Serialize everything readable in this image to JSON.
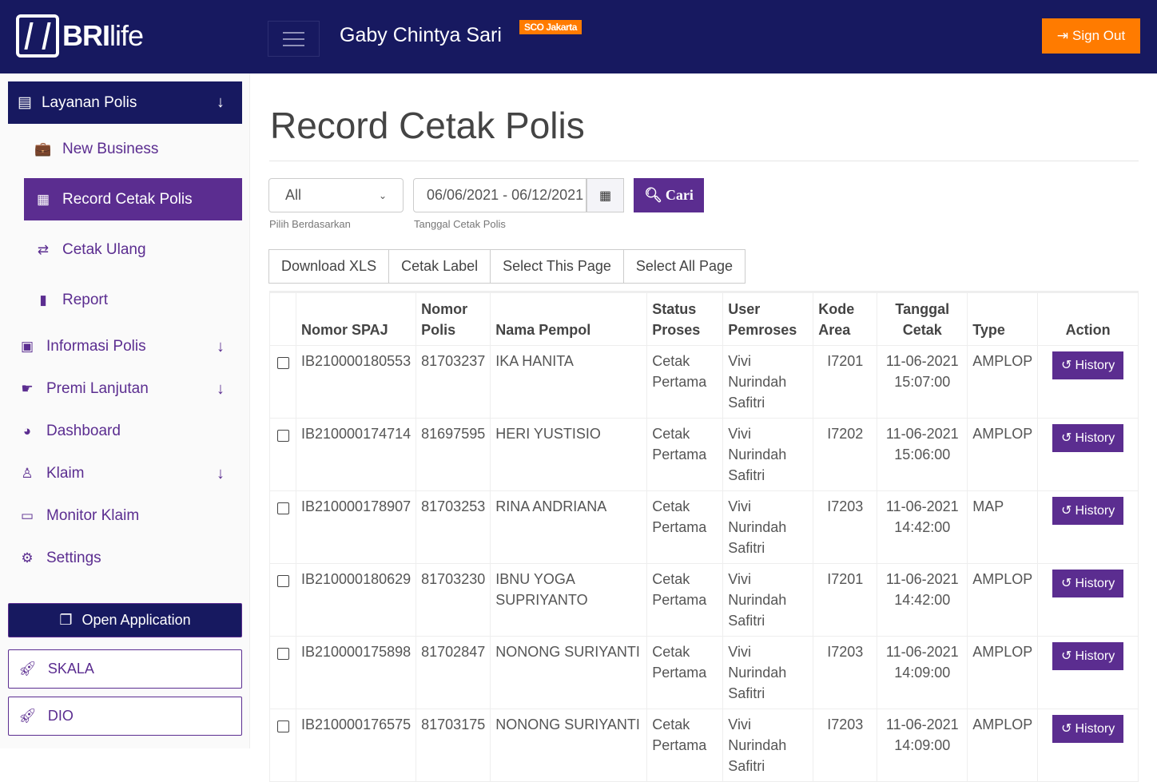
{
  "header": {
    "logo": "BRIlife",
    "user_name": "Gaby Chintya Sari",
    "branch_badge": "SCO Jakarta",
    "sign_out": "Sign Out"
  },
  "sidebar": {
    "section": "Layanan Polis",
    "sub_items": [
      {
        "label": "New Business",
        "icon": "briefcase-clock-icon"
      },
      {
        "label": "Record Cetak Polis",
        "icon": "receipt-icon",
        "active": true
      },
      {
        "label": "Cetak Ulang",
        "icon": "retweet-icon"
      },
      {
        "label": "Report",
        "icon": "book-icon"
      }
    ],
    "items": [
      {
        "label": "Informasi Polis",
        "icon": "id-badge-icon",
        "expandable": true
      },
      {
        "label": "Premi Lanjutan",
        "icon": "hand-money-icon",
        "expandable": true
      },
      {
        "label": "Dashboard",
        "icon": "gauge-icon"
      },
      {
        "label": "Klaim",
        "icon": "user-doctor-icon",
        "expandable": true
      },
      {
        "label": "Monitor Klaim",
        "icon": "desktop-icon"
      },
      {
        "label": "Settings",
        "icon": "users-cog-icon"
      }
    ],
    "open_application": "Open Application",
    "external": [
      "SKALA",
      "DIO"
    ]
  },
  "page": {
    "title": "Record Cetak Polis"
  },
  "filters": {
    "select_value": "All",
    "select_hint": "Pilih Berdasarkan",
    "date_value": "06/06/2021 - 06/12/2021",
    "date_hint": "Tanggal Cetak Polis",
    "search_label": "Cari"
  },
  "actions": [
    "Download XLS",
    "Cetak Label",
    "Select This Page",
    "Select All Page"
  ],
  "table": {
    "headers": [
      "Nomor SPAJ",
      "Nomor Polis",
      "Nama Pempol",
      "Status Proses",
      "User Pemroses",
      "Kode Area",
      "Tanggal Cetak",
      "Type",
      "Action"
    ],
    "history_label": "History",
    "rows": [
      {
        "spaj": "IB210000180553",
        "polis": "81703237",
        "nama": "IKA HANITA",
        "status": "Cetak Pertama",
        "user": "Vivi Nurindah Safitri",
        "area": "I7201",
        "tanggal": "11-06-2021 15:07:00",
        "type": "AMPLOP"
      },
      {
        "spaj": "IB210000174714",
        "polis": "81697595",
        "nama": "HERI YUSTISIO",
        "status": "Cetak Pertama",
        "user": "Vivi Nurindah Safitri",
        "area": "I7202",
        "tanggal": "11-06-2021 15:06:00",
        "type": "AMPLOP"
      },
      {
        "spaj": "IB210000178907",
        "polis": "81703253",
        "nama": "RINA ANDRIANA",
        "status": "Cetak Pertama",
        "user": "Vivi Nurindah Safitri",
        "area": "I7203",
        "tanggal": "11-06-2021 14:42:00",
        "type": "MAP"
      },
      {
        "spaj": "IB210000180629",
        "polis": "81703230",
        "nama": "IBNU YOGA SUPRIYANTO",
        "status": "Cetak Pertama",
        "user": "Vivi Nurindah Safitri",
        "area": "I7201",
        "tanggal": "11-06-2021 14:42:00",
        "type": "AMPLOP"
      },
      {
        "spaj": "IB210000175898",
        "polis": "81702847",
        "nama": "NONONG SURIYANTI",
        "status": "Cetak Pertama",
        "user": "Vivi Nurindah Safitri",
        "area": "I7203",
        "tanggal": "11-06-2021 14:09:00",
        "type": "AMPLOP"
      },
      {
        "spaj": "IB210000176575",
        "polis": "81703175",
        "nama": "NONONG SURIYANTI",
        "status": "Cetak Pertama",
        "user": "Vivi Nurindah Safitri",
        "area": "I7203",
        "tanggal": "11-06-2021 14:09:00",
        "type": "AMPLOP"
      }
    ]
  },
  "colors": {
    "navy": "#171960",
    "purple": "#5b2d90",
    "orange": "#ff7b00"
  }
}
